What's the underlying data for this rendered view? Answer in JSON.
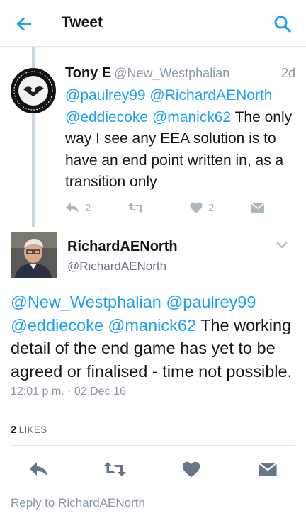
{
  "appbar": {
    "title": "Tweet",
    "back_icon": "arrow-left-icon",
    "search_icon": "search-icon",
    "accent": "#1da1f2"
  },
  "parent_tweet": {
    "name": "Tony E",
    "handle": "@New_Westphalian",
    "time": "2d",
    "mentions": [
      "@paulrey99",
      "@RichardAENorth",
      "@eddiecoke",
      "@manick62"
    ],
    "text": "The only way I see any EEA solution is to have an end point written in, as a transition only",
    "reply_count": "2",
    "like_count": "2"
  },
  "main_tweet": {
    "name": "RichardAENorth",
    "handle": "@RichardAENorth",
    "mentions": [
      "@New_Westphalian",
      "@paulrey99",
      "@eddiecoke",
      "@manick62"
    ],
    "text": "The working detail of the end game has yet to be agreed or finalised - time not possible.",
    "timestamp": "12:01 p.m. · 02 Dec 16",
    "likes_count": "2",
    "likes_label": "LIKES"
  },
  "reply_prompt": "Reply to RichardAENorth",
  "colors": {
    "mention": "#1da1f2",
    "muted": "#8899a6",
    "action_icon": "#657786",
    "action_icon_light": "#aab8c2"
  }
}
